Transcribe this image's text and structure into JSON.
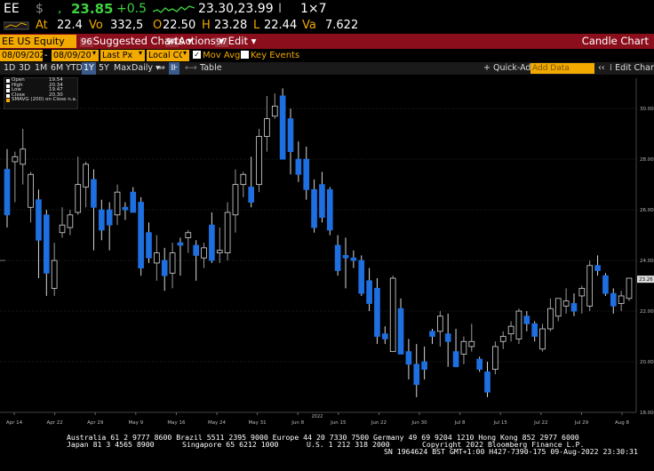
{
  "ticker": {
    "symbol": "EE",
    "currency_mark": "$",
    "last_price": "23.85",
    "change": "+0.5",
    "bid_ask": "23.30,23.99",
    "bid_ask_suffix": "I",
    "size": "1×7",
    "at_label": "At",
    "at_value": "22.4",
    "vol_label": "Vo",
    "vol_value": "332,5",
    "open_label": "O",
    "open_value": "22.50",
    "high_label": "H",
    "high_value": "23.28",
    "low_label": "L",
    "low_value": "22.44",
    "val_label": "Va",
    "val_value": "7.622"
  },
  "function_bar": {
    "security": "EE US Equity",
    "menu": [
      {
        "num": "96",
        "label": "Suggested Charts"
      },
      {
        "num": "94",
        "label": "Actions"
      },
      {
        "num": "97",
        "label": "Edit"
      }
    ],
    "chart_title": "Candle Chart"
  },
  "settings": {
    "start_date": "08/09/2021",
    "end_date": "08/09/2022",
    "price_field": "Last Px",
    "currency": "Local CCY",
    "mov_avgs": "Mov Avgs",
    "key_events": "Key Events"
  },
  "periods": {
    "items": [
      "1D",
      "3D",
      "1M",
      "6M",
      "YTD",
      "1Y",
      "5Y",
      "Max"
    ],
    "active": "1Y",
    "frequency": "Daily",
    "table": "Table",
    "quick_add": "Quick-Add",
    "add_data_placeholder": "Add Data",
    "edit_chart": "Edit Chart"
  },
  "legend": {
    "rows": [
      {
        "label": "Open",
        "value": "19.54"
      },
      {
        "label": "High",
        "value": "20.34"
      },
      {
        "label": "Low",
        "value": "19.47"
      },
      {
        "label": "Close",
        "value": "20.30"
      },
      {
        "label": "SMAVG (200) on Close",
        "value": "n.a."
      }
    ]
  },
  "colors": {
    "up": "#1e6fe0",
    "down_fill": "#000000",
    "down_stroke": "#d8d8d8",
    "amber": "#f2a900",
    "function_bar": "#8b0e1c",
    "grid": "#262626"
  },
  "chart_data": {
    "type": "candlestick",
    "ylim": [
      18.0,
      31.2
    ],
    "yticks": [
      "18.00",
      "20.00",
      "22.00",
      "24.00",
      "26.00",
      "28.00",
      "30.00"
    ],
    "last_price_label": "23.26",
    "year_label": "2022",
    "x_labels": [
      "Apr 14",
      "Apr 22",
      "Apr 29",
      "May 9",
      "May 16",
      "May 24",
      "May 31",
      "Jun 8",
      "Jun 15",
      "Jun 22",
      "Jun 30",
      "Jul 8",
      "Jul 15",
      "Jul 22",
      "Jul 29",
      "Aug 8"
    ],
    "candles": [
      {
        "o": 27.6,
        "h": 28.4,
        "l": 25.3,
        "c": 25.8
      },
      {
        "o": 27.9,
        "h": 28.3,
        "l": 26.3,
        "c": 28.1
      },
      {
        "o": 27.8,
        "h": 29.2,
        "l": 27.0,
        "c": 28.4
      },
      {
        "o": 26.1,
        "h": 27.5,
        "l": 25.5,
        "c": 27.4
      },
      {
        "o": 26.4,
        "h": 26.8,
        "l": 23.3,
        "c": 24.8
      },
      {
        "o": 25.8,
        "h": 26.0,
        "l": 22.6,
        "c": 23.5
      },
      {
        "o": 22.9,
        "h": 24.7,
        "l": 22.6,
        "c": 24.0
      },
      {
        "o": 25.1,
        "h": 26.1,
        "l": 24.9,
        "c": 25.4
      },
      {
        "o": 25.3,
        "h": 26.0,
        "l": 25.0,
        "c": 25.8
      },
      {
        "o": 25.9,
        "h": 28.1,
        "l": 25.8,
        "c": 27.0
      },
      {
        "o": 26.9,
        "h": 27.9,
        "l": 26.1,
        "c": 27.8
      },
      {
        "o": 27.2,
        "h": 27.6,
        "l": 24.4,
        "c": 26.1
      },
      {
        "o": 26.0,
        "h": 26.4,
        "l": 24.8,
        "c": 25.2
      },
      {
        "o": 26.0,
        "h": 26.3,
        "l": 24.4,
        "c": 25.4
      },
      {
        "o": 25.8,
        "h": 27.0,
        "l": 25.4,
        "c": 26.7
      },
      {
        "o": 26.1,
        "h": 26.3,
        "l": 25.6,
        "c": 26.0
      },
      {
        "o": 26.7,
        "h": 26.9,
        "l": 25.9,
        "c": 25.9
      },
      {
        "o": 26.3,
        "h": 26.5,
        "l": 23.4,
        "c": 23.7
      },
      {
        "o": 25.1,
        "h": 25.5,
        "l": 23.9,
        "c": 24.1
      },
      {
        "o": 23.9,
        "h": 25.0,
        "l": 23.2,
        "c": 24.3
      },
      {
        "o": 24.0,
        "h": 24.5,
        "l": 22.8,
        "c": 23.4
      },
      {
        "o": 23.5,
        "h": 24.7,
        "l": 22.9,
        "c": 24.3
      },
      {
        "o": 24.7,
        "h": 24.9,
        "l": 23.4,
        "c": 24.6
      },
      {
        "o": 24.9,
        "h": 25.2,
        "l": 24.3,
        "c": 25.1
      },
      {
        "o": 24.6,
        "h": 24.8,
        "l": 23.2,
        "c": 24.2
      },
      {
        "o": 24.1,
        "h": 24.7,
        "l": 23.7,
        "c": 24.5
      },
      {
        "o": 25.4,
        "h": 25.9,
        "l": 23.9,
        "c": 24.0
      },
      {
        "o": 24.3,
        "h": 25.3,
        "l": 23.9,
        "c": 24.4
      },
      {
        "o": 24.3,
        "h": 26.3,
        "l": 24.0,
        "c": 25.9
      },
      {
        "o": 25.8,
        "h": 27.6,
        "l": 25.1,
        "c": 27.0
      },
      {
        "o": 27.0,
        "h": 27.5,
        "l": 26.5,
        "c": 27.4
      },
      {
        "o": 26.9,
        "h": 28.1,
        "l": 26.1,
        "c": 26.3
      },
      {
        "o": 27.0,
        "h": 29.2,
        "l": 26.7,
        "c": 28.9
      },
      {
        "o": 28.9,
        "h": 30.5,
        "l": 28.3,
        "c": 29.6
      },
      {
        "o": 29.7,
        "h": 30.6,
        "l": 29.6,
        "c": 30.1
      },
      {
        "o": 30.5,
        "h": 30.8,
        "l": 28.3,
        "c": 28.0
      },
      {
        "o": 29.6,
        "h": 30.0,
        "l": 27.4,
        "c": 28.3
      },
      {
        "o": 28.0,
        "h": 28.7,
        "l": 27.1,
        "c": 27.4
      },
      {
        "o": 28.0,
        "h": 28.5,
        "l": 26.4,
        "c": 26.8
      },
      {
        "o": 26.8,
        "h": 27.2,
        "l": 25.1,
        "c": 25.3
      },
      {
        "o": 27.0,
        "h": 27.5,
        "l": 25.5,
        "c": 25.7
      },
      {
        "o": 26.8,
        "h": 26.9,
        "l": 25.0,
        "c": 25.2
      },
      {
        "o": 24.6,
        "h": 25.0,
        "l": 23.4,
        "c": 23.6
      },
      {
        "o": 24.2,
        "h": 24.9,
        "l": 22.9,
        "c": 24.1
      },
      {
        "o": 24.1,
        "h": 24.4,
        "l": 23.7,
        "c": 24.0
      },
      {
        "o": 24.0,
        "h": 24.2,
        "l": 22.6,
        "c": 22.7
      },
      {
        "o": 23.2,
        "h": 23.7,
        "l": 22.0,
        "c": 22.3
      },
      {
        "o": 22.9,
        "h": 23.3,
        "l": 20.7,
        "c": 21.0
      },
      {
        "o": 21.1,
        "h": 21.4,
        "l": 20.7,
        "c": 20.9
      },
      {
        "o": 20.4,
        "h": 23.4,
        "l": 20.4,
        "c": 23.3
      },
      {
        "o": 22.1,
        "h": 22.5,
        "l": 20.3,
        "c": 20.3
      },
      {
        "o": 20.4,
        "h": 20.9,
        "l": 19.3,
        "c": 19.9
      },
      {
        "o": 19.9,
        "h": 20.7,
        "l": 18.6,
        "c": 19.1
      },
      {
        "o": 20.0,
        "h": 20.6,
        "l": 19.3,
        "c": 19.7
      },
      {
        "o": 21.2,
        "h": 21.3,
        "l": 20.7,
        "c": 21.0
      },
      {
        "o": 21.2,
        "h": 22.0,
        "l": 20.6,
        "c": 21.8
      },
      {
        "o": 21.1,
        "h": 21.9,
        "l": 19.8,
        "c": 20.8
      },
      {
        "o": 20.4,
        "h": 21.3,
        "l": 19.8,
        "c": 19.8
      },
      {
        "o": 20.3,
        "h": 21.0,
        "l": 19.9,
        "c": 20.8
      },
      {
        "o": 20.6,
        "h": 21.5,
        "l": 20.4,
        "c": 20.8
      },
      {
        "o": 20.1,
        "h": 20.2,
        "l": 19.6,
        "c": 19.7
      },
      {
        "o": 19.6,
        "h": 20.0,
        "l": 18.6,
        "c": 18.8
      },
      {
        "o": 19.7,
        "h": 20.8,
        "l": 19.5,
        "c": 20.6
      },
      {
        "o": 20.8,
        "h": 21.2,
        "l": 20.5,
        "c": 21.0
      },
      {
        "o": 21.1,
        "h": 21.6,
        "l": 20.8,
        "c": 21.4
      },
      {
        "o": 20.9,
        "h": 22.1,
        "l": 20.7,
        "c": 22.0
      },
      {
        "o": 21.8,
        "h": 22.0,
        "l": 21.2,
        "c": 21.5
      },
      {
        "o": 21.5,
        "h": 21.6,
        "l": 20.8,
        "c": 21.0
      },
      {
        "o": 20.5,
        "h": 21.5,
        "l": 20.4,
        "c": 21.3
      },
      {
        "o": 21.3,
        "h": 22.5,
        "l": 21.2,
        "c": 22.1
      },
      {
        "o": 21.8,
        "h": 22.5,
        "l": 21.6,
        "c": 22.5
      },
      {
        "o": 22.2,
        "h": 22.9,
        "l": 21.9,
        "c": 22.4
      },
      {
        "o": 22.3,
        "h": 22.7,
        "l": 21.8,
        "c": 22.0
      },
      {
        "o": 22.6,
        "h": 23.0,
        "l": 21.9,
        "c": 22.9
      },
      {
        "o": 22.2,
        "h": 24.0,
        "l": 22.0,
        "c": 23.8
      },
      {
        "o": 23.8,
        "h": 24.2,
        "l": 23.4,
        "c": 23.6
      },
      {
        "o": 23.4,
        "h": 23.5,
        "l": 22.6,
        "c": 22.7
      },
      {
        "o": 22.7,
        "h": 22.9,
        "l": 21.9,
        "c": 22.2
      },
      {
        "o": 22.3,
        "h": 22.8,
        "l": 22.0,
        "c": 22.6
      },
      {
        "o": 22.5,
        "h": 23.3,
        "l": 22.4,
        "c": 23.3
      }
    ]
  },
  "footer": {
    "line1": "Australia 61 2 9777 8600  Brazil 5511 2395 9000  Europe 44 20 7330 7500  Germany 49 69 9204 1210  Hong Kong 852 2977 6000",
    "line2a": "Japan 81 3 4565 8900",
    "line2b": "Singapore 65 6212 1000",
    "line2c": "U.S. 1 212 318 2000",
    "line2d": "Copyright 2022 Bloomberg Finance L.P.",
    "line3": "SN 1964624 BST  GMT+1:00 H427-7390-175 09-Aug-2022 23:30:31"
  }
}
